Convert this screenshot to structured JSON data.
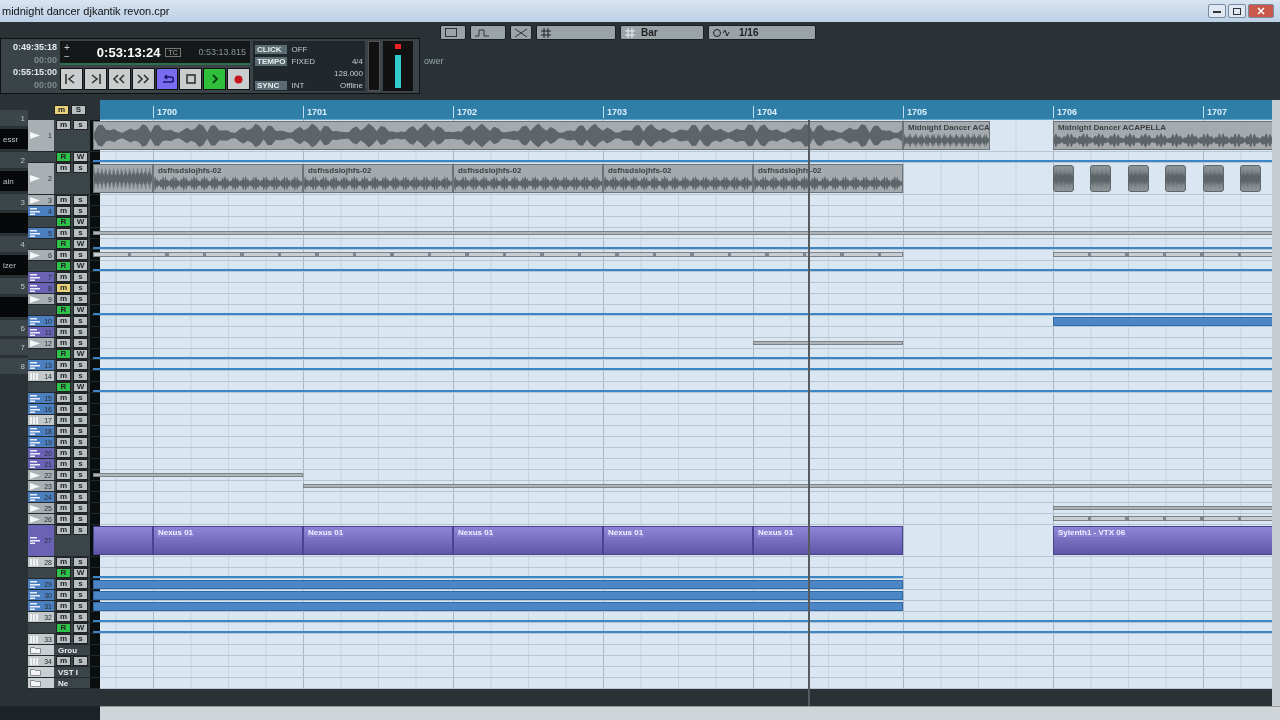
{
  "window": {
    "title": "midnight dancer djkantik revon.cpr"
  },
  "toolbar": {
    "quantize_grid": "Bar",
    "quantize_value": "1/16",
    "panel_tab": "ower"
  },
  "transport": {
    "left_times": [
      {
        "time": "0:49:35:18",
        "sub": "00:00"
      },
      {
        "time": "0:55:15:00",
        "sub": "00:00"
      }
    ],
    "plus": "+",
    "minus": "−",
    "main_time": "0:53:13:24",
    "time_format": "TC",
    "secondary_time": "0:53:13.815",
    "buttons": [
      {
        "kind": "start",
        "selected": false
      },
      {
        "kind": "end",
        "selected": false
      },
      {
        "kind": "rewind",
        "selected": false
      },
      {
        "kind": "forward",
        "selected": false
      },
      {
        "kind": "cycle",
        "selected": true
      },
      {
        "kind": "stop",
        "selected": false
      },
      {
        "kind": "play",
        "selected": true
      },
      {
        "kind": "record",
        "selected": false
      }
    ],
    "click": {
      "label": "CLICK",
      "value": "OFF"
    },
    "tempo": {
      "label": "TEMPO",
      "mode": "FIXED",
      "signature": "4/4",
      "value": "128.000"
    },
    "sync": {
      "label": "SYNC",
      "source": "INT",
      "status": "Offline"
    }
  },
  "header": {
    "mute_label": "m",
    "mute_active": true,
    "solo_label": "S"
  },
  "inspector": [
    {
      "kind": "slot",
      "label": "1"
    },
    {
      "kind": "plugin",
      "label": "essr"
    },
    {
      "kind": "slot",
      "label": "2"
    },
    {
      "kind": "plugin",
      "label": "ain"
    },
    {
      "kind": "slot",
      "label": "3"
    },
    {
      "kind": "plugin"
    },
    {
      "kind": "slot",
      "label": "4"
    },
    {
      "kind": "plugin",
      "label": "izer"
    },
    {
      "kind": "slot",
      "label": "5"
    },
    {
      "kind": "plugin"
    },
    {
      "kind": "slot",
      "label": "6"
    },
    {
      "kind": "slot",
      "label": "7"
    },
    {
      "kind": "slot",
      "label": "8"
    }
  ],
  "ruler": {
    "bars": [
      "1700",
      "1701",
      "1702",
      "1703",
      "1704",
      "1705",
      "1706",
      "1707"
    ]
  },
  "rows": [
    {
      "kind": "audio",
      "number": "1",
      "expanded": true,
      "mute": "m",
      "solo": "s",
      "muted": false,
      "parts": [
        {
          "kind": "audio"
        },
        {
          "kind": "audio",
          "label": "Midnight Dancer ACA"
        },
        {
          "kind": "audio",
          "label": "Midnight Dancer ACAPELLA"
        }
      ]
    },
    {
      "kind": "automation",
      "read_label": "R",
      "write_label": "W",
      "read": true,
      "write": false,
      "parts": [
        {
          "kind": "line"
        }
      ]
    },
    {
      "kind": "audio",
      "number": "2",
      "expanded": true,
      "mute": "m",
      "solo": "s",
      "muted": false,
      "parts": [
        {
          "kind": "audio"
        },
        {
          "kind": "audio",
          "label": "dsfhsdslojhfs-02"
        },
        {
          "kind": "audio",
          "label": "dsfhsdslojhfs-02"
        },
        {
          "kind": "audio",
          "label": "dsfhsdslojhfs-02"
        },
        {
          "kind": "audio",
          "label": "dsfhsdslojhfs-02"
        },
        {
          "kind": "audio",
          "label": "dsfhsdslojhfs-02"
        },
        {
          "kind": "hit"
        },
        {
          "kind": "hit"
        },
        {
          "kind": "hit"
        },
        {
          "kind": "hit"
        },
        {
          "kind": "hit"
        },
        {
          "kind": "hit"
        }
      ]
    },
    {
      "kind": "audio",
      "number": "3",
      "expanded": false,
      "mute": "m",
      "solo": "s",
      "muted": false
    },
    {
      "kind": "midi",
      "number": "4",
      "expanded": false,
      "mute": "m",
      "solo": "s",
      "muted": false
    },
    {
      "kind": "automation",
      "read_label": "R",
      "write_label": "W",
      "read": true,
      "write": false
    },
    {
      "kind": "midi",
      "number": "5",
      "expanded": false,
      "mute": "m",
      "solo": "s",
      "muted": false,
      "parts": [
        {
          "kind": "strip"
        }
      ]
    },
    {
      "kind": "automation",
      "read_label": "R",
      "write_label": "W",
      "read": true,
      "write": false,
      "parts": [
        {
          "kind": "line"
        }
      ]
    },
    {
      "kind": "audio",
      "number": "6",
      "expanded": false,
      "mute": "m",
      "solo": "s",
      "muted": false,
      "parts": [
        {
          "kind": "segments"
        },
        {
          "kind": "segments"
        }
      ]
    },
    {
      "kind": "automation",
      "read_label": "R",
      "write_label": "W",
      "read": true,
      "write": false,
      "parts": [
        {
          "kind": "line"
        }
      ]
    },
    {
      "kind": "instrument",
      "number": "7",
      "expanded": false,
      "mute": "m",
      "solo": "s",
      "muted": false
    },
    {
      "kind": "instrument",
      "number": "8",
      "expanded": false,
      "mute": "m",
      "solo": "s",
      "muted": true
    },
    {
      "kind": "audio",
      "number": "9",
      "expanded": false,
      "mute": "m",
      "solo": "s",
      "muted": false
    },
    {
      "kind": "automation",
      "read_label": "R",
      "write_label": "W",
      "read": true,
      "write": false,
      "parts": [
        {
          "kind": "line"
        }
      ]
    },
    {
      "kind": "midi",
      "number": "10",
      "expanded": false,
      "mute": "m",
      "solo": "s",
      "muted": false,
      "parts": [
        {
          "kind": "band"
        }
      ]
    },
    {
      "kind": "instrument",
      "number": "11",
      "expanded": false,
      "mute": "m",
      "solo": "s",
      "muted": false
    },
    {
      "kind": "audio",
      "number": "12",
      "expanded": false,
      "mute": "m",
      "solo": "s",
      "muted": false,
      "parts": [
        {
          "kind": "strip"
        }
      ]
    },
    {
      "kind": "automation",
      "read_label": "R",
      "write_label": "W",
      "read": true,
      "write": false,
      "parts": [
        {
          "kind": "line"
        }
      ]
    },
    {
      "kind": "midi",
      "number": "13",
      "expanded": false,
      "mute": "m",
      "solo": "s",
      "muted": false,
      "parts": [
        {
          "kind": "line"
        }
      ]
    },
    {
      "kind": "drum",
      "number": "14",
      "expanded": false,
      "mute": "m",
      "solo": "s",
      "muted": false
    },
    {
      "kind": "automation",
      "read_label": "R",
      "write_label": "W",
      "read": true,
      "write": false,
      "parts": [
        {
          "kind": "line"
        }
      ]
    },
    {
      "kind": "midi",
      "number": "15",
      "expanded": false,
      "mute": "m",
      "solo": "s",
      "muted": false
    },
    {
      "kind": "midi",
      "number": "16",
      "expanded": false,
      "mute": "m",
      "solo": "s",
      "muted": false
    },
    {
      "kind": "drum",
      "number": "17",
      "expanded": false,
      "mute": "m",
      "solo": "s",
      "muted": false
    },
    {
      "kind": "midi",
      "number": "18",
      "expanded": false,
      "mute": "m",
      "solo": "s",
      "muted": false
    },
    {
      "kind": "midi",
      "number": "19",
      "expanded": false,
      "mute": "m",
      "solo": "s",
      "muted": false
    },
    {
      "kind": "instrument",
      "number": "20",
      "expanded": false,
      "mute": "m",
      "solo": "s",
      "muted": false
    },
    {
      "kind": "instrument",
      "number": "21",
      "expanded": false,
      "mute": "m",
      "solo": "s",
      "muted": false
    },
    {
      "kind": "audio",
      "number": "22",
      "expanded": false,
      "mute": "m",
      "solo": "s",
      "muted": false,
      "parts": [
        {
          "kind": "strip"
        }
      ]
    },
    {
      "kind": "audio",
      "number": "23",
      "expanded": false,
      "mute": "m",
      "solo": "s",
      "muted": false,
      "parts": [
        {
          "kind": "strip"
        }
      ]
    },
    {
      "kind": "midi",
      "number": "24",
      "expanded": false,
      "mute": "m",
      "solo": "s",
      "muted": false
    },
    {
      "kind": "audio",
      "number": "25",
      "expanded": false,
      "mute": "m",
      "solo": "s",
      "muted": false,
      "parts": [
        {
          "kind": "strip"
        }
      ]
    },
    {
      "kind": "audio",
      "number": "26",
      "expanded": false,
      "mute": "m",
      "solo": "s",
      "muted": false,
      "parts": [
        {
          "kind": "segments"
        }
      ]
    },
    {
      "kind": "instrument",
      "number": "27",
      "expanded": true,
      "mute": "m",
      "solo": "s",
      "muted": false,
      "parts": [
        {
          "kind": "instrument"
        },
        {
          "kind": "instrument",
          "label": "Nexus 01"
        },
        {
          "kind": "instrument",
          "label": "Nexus 01"
        },
        {
          "kind": "instrument",
          "label": "Nexus 01"
        },
        {
          "kind": "instrument",
          "label": "Nexus 01"
        },
        {
          "kind": "instrument",
          "label": "Nexus 01"
        },
        {
          "kind": "instrument",
          "label": "Sylenth1 - VTX 06"
        }
      ]
    },
    {
      "kind": "drum",
      "number": "28",
      "expanded": false,
      "mute": "m",
      "solo": "s",
      "muted": false
    },
    {
      "kind": "automation",
      "read_label": "R",
      "write_label": "W",
      "read": true,
      "write": false,
      "parts": [
        {
          "kind": "line"
        }
      ]
    },
    {
      "kind": "midi",
      "number": "29",
      "expanded": false,
      "mute": "m",
      "solo": "s",
      "muted": false,
      "parts": [
        {
          "kind": "band"
        }
      ]
    },
    {
      "kind": "midi",
      "number": "30",
      "expanded": false,
      "mute": "m",
      "solo": "s",
      "muted": false,
      "parts": [
        {
          "kind": "band"
        }
      ]
    },
    {
      "kind": "midi",
      "number": "31",
      "expanded": false,
      "mute": "m",
      "solo": "s",
      "muted": false,
      "parts": [
        {
          "kind": "band"
        }
      ]
    },
    {
      "kind": "drum",
      "number": "32",
      "expanded": false,
      "mute": "m",
      "solo": "s",
      "muted": false,
      "parts": [
        {
          "kind": "line"
        }
      ]
    },
    {
      "kind": "automation",
      "read_label": "R",
      "write_label": "W",
      "read": true,
      "write": false,
      "parts": [
        {
          "kind": "line"
        }
      ]
    },
    {
      "kind": "drum",
      "number": "33",
      "expanded": false,
      "mute": "m",
      "solo": "s",
      "muted": false
    },
    {
      "kind": "folder",
      "label": "Grou"
    },
    {
      "kind": "drum",
      "number": "34",
      "expanded": false,
      "mute": "m",
      "solo": "s",
      "muted": false
    },
    {
      "kind": "folder",
      "label": "VST I"
    },
    {
      "kind": "folder",
      "label": "Ne"
    }
  ]
}
